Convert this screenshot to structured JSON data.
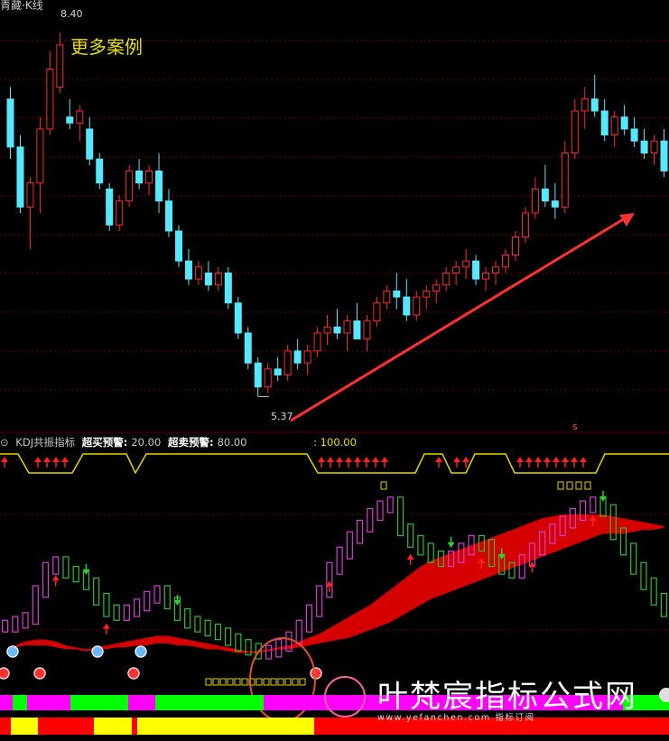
{
  "header": {
    "top_title": "青藏·K线",
    "example_link": "更多案例",
    "indicator_name": "KDJ共振指标",
    "oversold_label": "超买预警:",
    "oversold_value": "20.00",
    "overbought_label": "超卖预警:",
    "overbought_value": "80.00",
    "extra_value": ": 100.00"
  },
  "annotations": {
    "high_price": "8.40",
    "low_price": "5.37",
    "s_marker": "s"
  },
  "watermark": {
    "cn": "叶梵宸指标公式网",
    "en": "www.yefanchen.com 指标订阅"
  },
  "colors": {
    "up": "#ff2a2a",
    "down": "#55e8ff",
    "kdj_up": "#d23fd2",
    "kdj_down": "#2fbf2f",
    "cloud": "#e00000",
    "teal": "#14a0a0"
  },
  "chart_data": [
    {
      "type": "candlestick",
      "title": "",
      "ylim": [
        5.2,
        8.6
      ],
      "candles": [
        [
          7.85,
          7.95,
          7.35,
          7.45
        ],
        [
          7.45,
          7.55,
          6.9,
          6.95
        ],
        [
          6.95,
          7.2,
          6.6,
          7.15
        ],
        [
          7.15,
          7.7,
          6.9,
          7.6
        ],
        [
          7.6,
          8.25,
          7.55,
          8.1
        ],
        [
          7.95,
          8.4,
          7.9,
          8.3
        ],
        [
          7.7,
          7.85,
          7.6,
          7.65
        ],
        [
          7.65,
          7.8,
          7.5,
          7.75
        ],
        [
          7.6,
          7.7,
          7.3,
          7.35
        ],
        [
          7.35,
          7.4,
          7.1,
          7.15
        ],
        [
          7.1,
          7.15,
          6.75,
          6.8
        ],
        [
          6.8,
          7.05,
          6.75,
          7.0
        ],
        [
          7.0,
          7.3,
          6.95,
          7.25
        ],
        [
          7.25,
          7.35,
          7.1,
          7.15
        ],
        [
          7.15,
          7.3,
          7.05,
          7.25
        ],
        [
          7.25,
          7.4,
          6.9,
          7.0
        ],
        [
          7.0,
          7.1,
          6.7,
          6.75
        ],
        [
          6.75,
          6.8,
          6.45,
          6.5
        ],
        [
          6.5,
          6.6,
          6.3,
          6.35
        ],
        [
          6.35,
          6.5,
          6.3,
          6.45
        ],
        [
          6.4,
          6.5,
          6.25,
          6.3
        ],
        [
          6.3,
          6.45,
          6.25,
          6.4
        ],
        [
          6.4,
          6.45,
          6.1,
          6.15
        ],
        [
          6.15,
          6.2,
          5.85,
          5.9
        ],
        [
          5.9,
          5.95,
          5.6,
          5.65
        ],
        [
          5.65,
          5.7,
          5.37,
          5.45
        ],
        [
          5.45,
          5.65,
          5.4,
          5.6
        ],
        [
          5.6,
          5.7,
          5.5,
          5.55
        ],
        [
          5.55,
          5.8,
          5.5,
          5.75
        ],
        [
          5.75,
          5.85,
          5.6,
          5.65
        ],
        [
          5.65,
          5.8,
          5.55,
          5.75
        ],
        [
          5.75,
          5.95,
          5.7,
          5.9
        ],
        [
          5.9,
          6.05,
          5.8,
          5.95
        ],
        [
          5.95,
          6.1,
          5.85,
          5.9
        ],
        [
          5.9,
          6.05,
          5.75,
          6.0
        ],
        [
          6.0,
          6.15,
          5.95,
          5.85
        ],
        [
          5.85,
          6.05,
          5.75,
          6.0
        ],
        [
          6.0,
          6.2,
          5.95,
          6.15
        ],
        [
          6.15,
          6.3,
          6.1,
          6.25
        ],
        [
          6.25,
          6.4,
          6.1,
          6.2
        ],
        [
          6.2,
          6.35,
          6.0,
          6.05
        ],
        [
          6.05,
          6.25,
          6.0,
          6.2
        ],
        [
          6.2,
          6.3,
          6.1,
          6.25
        ],
        [
          6.25,
          6.35,
          6.15,
          6.3
        ],
        [
          6.3,
          6.45,
          6.25,
          6.4
        ],
        [
          6.4,
          6.5,
          6.3,
          6.45
        ],
        [
          6.45,
          6.6,
          6.35,
          6.5
        ],
        [
          6.5,
          6.55,
          6.3,
          6.35
        ],
        [
          6.35,
          6.45,
          6.25,
          6.4
        ],
        [
          6.4,
          6.5,
          6.3,
          6.45
        ],
        [
          6.45,
          6.6,
          6.4,
          6.55
        ],
        [
          6.55,
          6.75,
          6.5,
          6.7
        ],
        [
          6.7,
          6.95,
          6.65,
          6.9
        ],
        [
          6.9,
          7.2,
          6.85,
          7.1
        ],
        [
          7.1,
          7.3,
          6.95,
          7.0
        ],
        [
          7.0,
          7.15,
          6.85,
          6.95
        ],
        [
          6.95,
          7.5,
          6.9,
          7.4
        ],
        [
          7.4,
          7.85,
          7.35,
          7.75
        ],
        [
          7.75,
          7.95,
          7.6,
          7.85
        ],
        [
          7.85,
          8.05,
          7.7,
          7.75
        ],
        [
          7.75,
          7.85,
          7.5,
          7.55
        ],
        [
          7.55,
          7.75,
          7.45,
          7.7
        ],
        [
          7.7,
          7.8,
          7.55,
          7.6
        ],
        [
          7.6,
          7.7,
          7.45,
          7.5
        ],
        [
          7.5,
          7.6,
          7.35,
          7.4
        ],
        [
          7.4,
          7.55,
          7.3,
          7.5
        ],
        [
          7.5,
          7.6,
          7.2,
          7.25
        ]
      ]
    },
    {
      "type": "line",
      "title": "",
      "ylim": [
        -10,
        110
      ],
      "thresholds": [
        20,
        80,
        100
      ],
      "kdj_values": [
        22,
        24,
        26,
        40,
        52,
        55,
        50,
        48,
        44,
        36,
        30,
        28,
        30,
        33,
        37,
        40,
        34,
        28,
        24,
        22,
        20,
        18,
        15,
        12,
        10,
        8,
        9,
        12,
        16,
        22,
        30,
        40,
        52,
        60,
        68,
        74,
        80,
        84,
        86,
        72,
        66,
        62,
        58,
        56,
        58,
        62,
        66,
        64,
        56,
        52,
        50,
        56,
        62,
        68,
        72,
        76,
        80,
        84,
        86,
        82,
        70,
        62,
        52,
        44,
        36,
        30
      ],
      "cloud_upper": [
        10,
        12,
        14,
        15,
        15,
        14,
        12,
        11,
        10,
        11,
        12,
        13,
        14,
        15,
        16,
        17,
        17,
        16,
        15,
        14,
        13,
        12,
        11,
        10,
        9,
        9,
        10,
        11,
        12,
        14,
        16,
        18,
        21,
        24,
        27,
        30,
        33,
        37,
        41,
        45,
        49,
        53,
        56,
        58,
        60,
        62,
        64,
        66,
        68,
        70,
        72,
        74,
        76,
        78,
        79,
        80,
        80,
        80,
        80,
        80,
        79,
        78,
        77,
        76,
        75,
        74
      ],
      "cloud_lower": [
        10,
        11,
        12,
        12,
        12,
        11,
        10,
        10,
        9,
        10,
        10,
        11,
        11,
        12,
        12,
        13,
        13,
        12,
        12,
        11,
        10,
        10,
        9,
        8,
        8,
        8,
        9,
        10,
        10,
        11,
        12,
        13,
        14,
        15,
        16,
        18,
        20,
        22,
        24,
        27,
        30,
        33,
        36,
        38,
        40,
        42,
        44,
        46,
        48,
        50,
        52,
        54,
        56,
        58,
        60,
        62,
        64,
        66,
        68,
        70,
        70,
        70,
        71,
        72,
        72,
        73
      ],
      "buy_arrow_indices": [
        5,
        10,
        32,
        40,
        47,
        52,
        58
      ],
      "sell_arrow_indices": [
        8,
        17,
        44,
        49,
        59
      ]
    }
  ]
}
